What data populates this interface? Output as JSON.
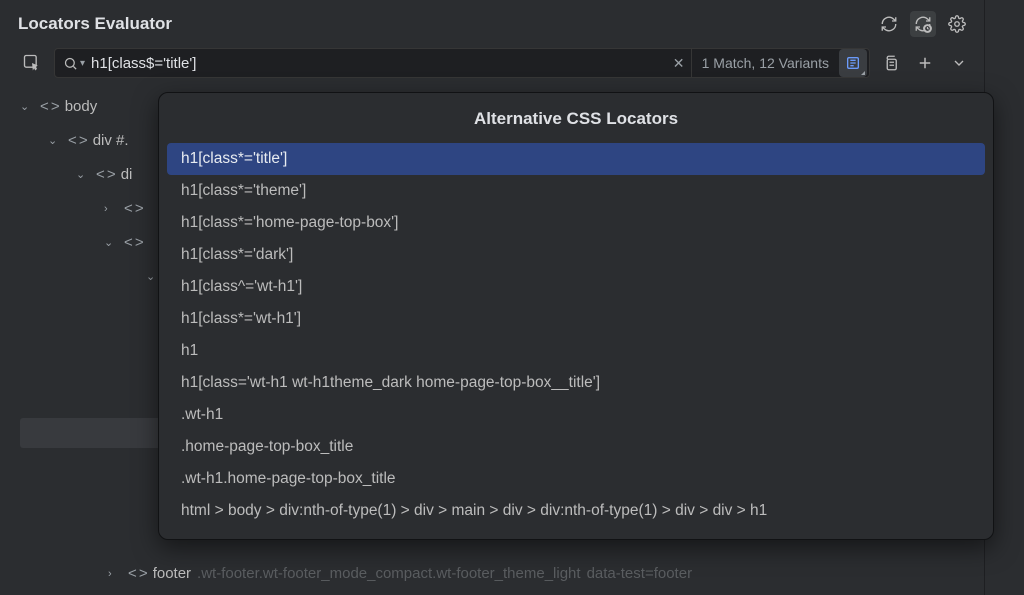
{
  "header": {
    "title": "Locators Evaluator"
  },
  "search": {
    "value": "h1[class$='title']",
    "match_info": "1 Match, 12 Variants"
  },
  "tree": {
    "rows": [
      {
        "indent": 1,
        "arrow": "down",
        "label": "body"
      },
      {
        "indent": 2,
        "arrow": "down",
        "label": "div #."
      },
      {
        "indent": 3,
        "arrow": "down",
        "label": "di"
      },
      {
        "indent": 4,
        "arrow": "right",
        "label": ""
      },
      {
        "indent": 4,
        "arrow": "down",
        "label": ""
      },
      {
        "indent": 5,
        "arrow": "down",
        "label": ""
      }
    ]
  },
  "footer": {
    "tag": "footer",
    "classes": ".wt-footer.wt-footer_mode_compact.wt-footer_theme_light",
    "attr": "data-test=footer"
  },
  "popup": {
    "title": "Alternative CSS Locators",
    "items": [
      "h1[class*='title']",
      "h1[class*='theme']",
      "h1[class*='home-page-top-box']",
      "h1[class*='dark']",
      "h1[class^='wt-h1']",
      "h1[class*='wt-h1']",
      "h1",
      "h1[class='wt-h1 wt-h1theme_dark home-page-top-box__title']",
      ".wt-h1",
      ".home-page-top-box_title",
      ".wt-h1.home-page-top-box_title",
      "html > body > div:nth-of-type(1) > div > main > div > div:nth-of-type(1) > div > div > h1"
    ],
    "selected_index": 0
  }
}
